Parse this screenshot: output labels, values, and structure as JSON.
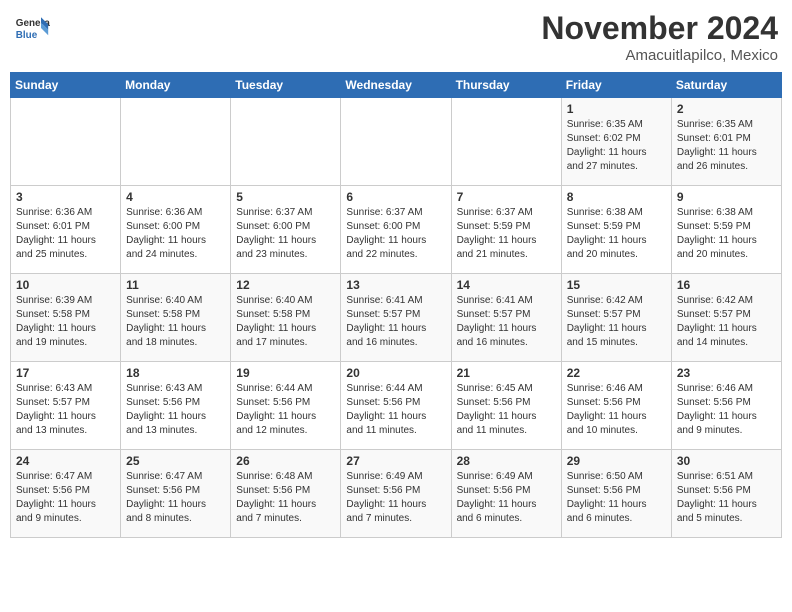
{
  "header": {
    "logo_general": "General",
    "logo_blue": "Blue",
    "month_title": "November 2024",
    "location": "Amacuitlapilco, Mexico"
  },
  "weekdays": [
    "Sunday",
    "Monday",
    "Tuesday",
    "Wednesday",
    "Thursday",
    "Friday",
    "Saturday"
  ],
  "weeks": [
    [
      {
        "day": "",
        "info": ""
      },
      {
        "day": "",
        "info": ""
      },
      {
        "day": "",
        "info": ""
      },
      {
        "day": "",
        "info": ""
      },
      {
        "day": "",
        "info": ""
      },
      {
        "day": "1",
        "info": "Sunrise: 6:35 AM\nSunset: 6:02 PM\nDaylight: 11 hours\nand 27 minutes."
      },
      {
        "day": "2",
        "info": "Sunrise: 6:35 AM\nSunset: 6:01 PM\nDaylight: 11 hours\nand 26 minutes."
      }
    ],
    [
      {
        "day": "3",
        "info": "Sunrise: 6:36 AM\nSunset: 6:01 PM\nDaylight: 11 hours\nand 25 minutes."
      },
      {
        "day": "4",
        "info": "Sunrise: 6:36 AM\nSunset: 6:00 PM\nDaylight: 11 hours\nand 24 minutes."
      },
      {
        "day": "5",
        "info": "Sunrise: 6:37 AM\nSunset: 6:00 PM\nDaylight: 11 hours\nand 23 minutes."
      },
      {
        "day": "6",
        "info": "Sunrise: 6:37 AM\nSunset: 6:00 PM\nDaylight: 11 hours\nand 22 minutes."
      },
      {
        "day": "7",
        "info": "Sunrise: 6:37 AM\nSunset: 5:59 PM\nDaylight: 11 hours\nand 21 minutes."
      },
      {
        "day": "8",
        "info": "Sunrise: 6:38 AM\nSunset: 5:59 PM\nDaylight: 11 hours\nand 20 minutes."
      },
      {
        "day": "9",
        "info": "Sunrise: 6:38 AM\nSunset: 5:59 PM\nDaylight: 11 hours\nand 20 minutes."
      }
    ],
    [
      {
        "day": "10",
        "info": "Sunrise: 6:39 AM\nSunset: 5:58 PM\nDaylight: 11 hours\nand 19 minutes."
      },
      {
        "day": "11",
        "info": "Sunrise: 6:40 AM\nSunset: 5:58 PM\nDaylight: 11 hours\nand 18 minutes."
      },
      {
        "day": "12",
        "info": "Sunrise: 6:40 AM\nSunset: 5:58 PM\nDaylight: 11 hours\nand 17 minutes."
      },
      {
        "day": "13",
        "info": "Sunrise: 6:41 AM\nSunset: 5:57 PM\nDaylight: 11 hours\nand 16 minutes."
      },
      {
        "day": "14",
        "info": "Sunrise: 6:41 AM\nSunset: 5:57 PM\nDaylight: 11 hours\nand 16 minutes."
      },
      {
        "day": "15",
        "info": "Sunrise: 6:42 AM\nSunset: 5:57 PM\nDaylight: 11 hours\nand 15 minutes."
      },
      {
        "day": "16",
        "info": "Sunrise: 6:42 AM\nSunset: 5:57 PM\nDaylight: 11 hours\nand 14 minutes."
      }
    ],
    [
      {
        "day": "17",
        "info": "Sunrise: 6:43 AM\nSunset: 5:57 PM\nDaylight: 11 hours\nand 13 minutes."
      },
      {
        "day": "18",
        "info": "Sunrise: 6:43 AM\nSunset: 5:56 PM\nDaylight: 11 hours\nand 13 minutes."
      },
      {
        "day": "19",
        "info": "Sunrise: 6:44 AM\nSunset: 5:56 PM\nDaylight: 11 hours\nand 12 minutes."
      },
      {
        "day": "20",
        "info": "Sunrise: 6:44 AM\nSunset: 5:56 PM\nDaylight: 11 hours\nand 11 minutes."
      },
      {
        "day": "21",
        "info": "Sunrise: 6:45 AM\nSunset: 5:56 PM\nDaylight: 11 hours\nand 11 minutes."
      },
      {
        "day": "22",
        "info": "Sunrise: 6:46 AM\nSunset: 5:56 PM\nDaylight: 11 hours\nand 10 minutes."
      },
      {
        "day": "23",
        "info": "Sunrise: 6:46 AM\nSunset: 5:56 PM\nDaylight: 11 hours\nand 9 minutes."
      }
    ],
    [
      {
        "day": "24",
        "info": "Sunrise: 6:47 AM\nSunset: 5:56 PM\nDaylight: 11 hours\nand 9 minutes."
      },
      {
        "day": "25",
        "info": "Sunrise: 6:47 AM\nSunset: 5:56 PM\nDaylight: 11 hours\nand 8 minutes."
      },
      {
        "day": "26",
        "info": "Sunrise: 6:48 AM\nSunset: 5:56 PM\nDaylight: 11 hours\nand 7 minutes."
      },
      {
        "day": "27",
        "info": "Sunrise: 6:49 AM\nSunset: 5:56 PM\nDaylight: 11 hours\nand 7 minutes."
      },
      {
        "day": "28",
        "info": "Sunrise: 6:49 AM\nSunset: 5:56 PM\nDaylight: 11 hours\nand 6 minutes."
      },
      {
        "day": "29",
        "info": "Sunrise: 6:50 AM\nSunset: 5:56 PM\nDaylight: 11 hours\nand 6 minutes."
      },
      {
        "day": "30",
        "info": "Sunrise: 6:51 AM\nSunset: 5:56 PM\nDaylight: 11 hours\nand 5 minutes."
      }
    ]
  ]
}
